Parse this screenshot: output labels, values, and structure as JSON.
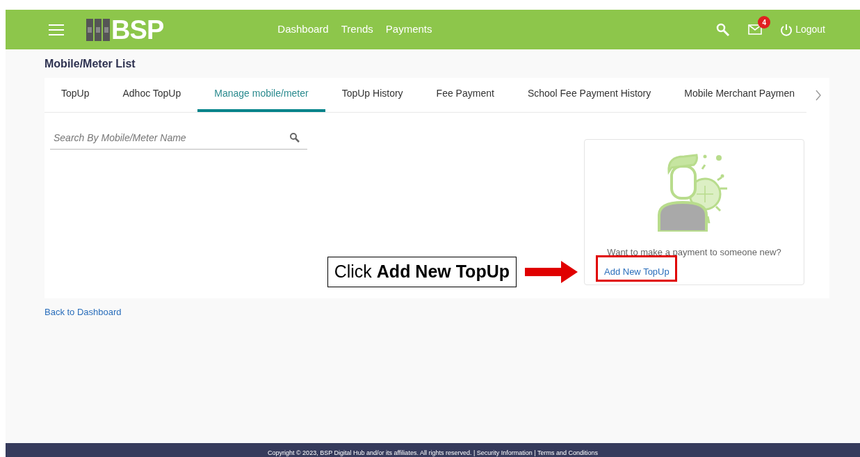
{
  "header": {
    "logo": "BSP",
    "nav": [
      "Dashboard",
      "Trends",
      "Payments"
    ],
    "mail_badge": "4",
    "logout": "Logout"
  },
  "page_title": "Mobile/Meter List",
  "tabs": [
    {
      "label": "TopUp",
      "selected": false
    },
    {
      "label": "Adhoc TopUp",
      "selected": false
    },
    {
      "label": "Manage mobile/meter",
      "selected": true
    },
    {
      "label": "TopUp History",
      "selected": false
    },
    {
      "label": "Fee Payment",
      "selected": false
    },
    {
      "label": "School Fee Payment History",
      "selected": false
    },
    {
      "label": "Mobile Merchant Paymen",
      "selected": false
    }
  ],
  "search": {
    "placeholder": "Search By Mobile/Meter Name"
  },
  "new_payee_card": {
    "prompt": "Want to make a payment to someone new?",
    "link": "Add New TopUp"
  },
  "annotation": "Click **Add New TopUp**",
  "back_link": "Back to Dashboard",
  "footer": "Copyright © 2023, BSP Digital Hub and/or its affiliates. All rights reserved. | Security Information | Terms and Conditions"
}
